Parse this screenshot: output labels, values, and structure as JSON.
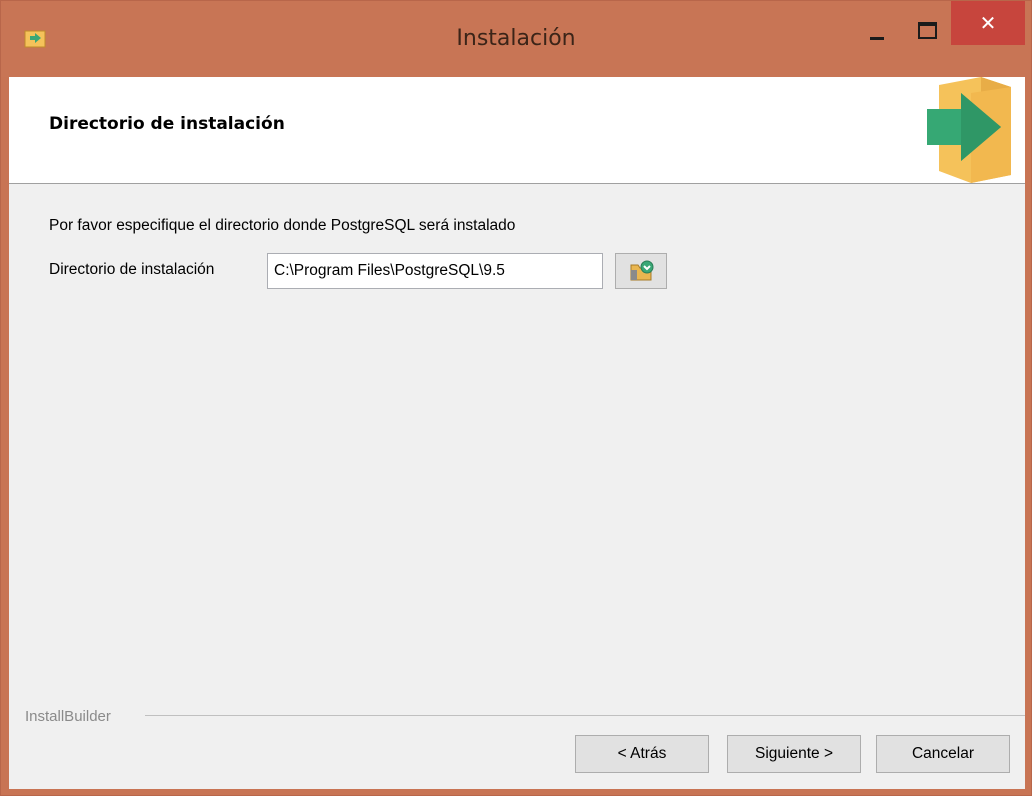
{
  "window": {
    "title": "Instalación",
    "controls": {
      "minimize": "minimize",
      "maximize": "maximize",
      "close": "✕"
    }
  },
  "header": {
    "title": "Directorio de instalación"
  },
  "content": {
    "description": "Por favor especifique el directorio donde PostgreSQL será instalado",
    "directory_label": "Directorio de instalación",
    "directory_value": "C:\\Program Files\\PostgreSQL\\9.5"
  },
  "footer": {
    "brand": "InstallBuilder",
    "back_label": "< Atrás",
    "next_label": "Siguiente >",
    "cancel_label": "Cancelar"
  },
  "colors": {
    "titlebar": "#c87555",
    "close_button": "#c7453d",
    "client_bg": "#f0f0f0"
  },
  "icons": {
    "app": "installer-box-arrow-icon",
    "header": "installer-box-arrow-icon",
    "browse": "folder-browse-icon"
  }
}
